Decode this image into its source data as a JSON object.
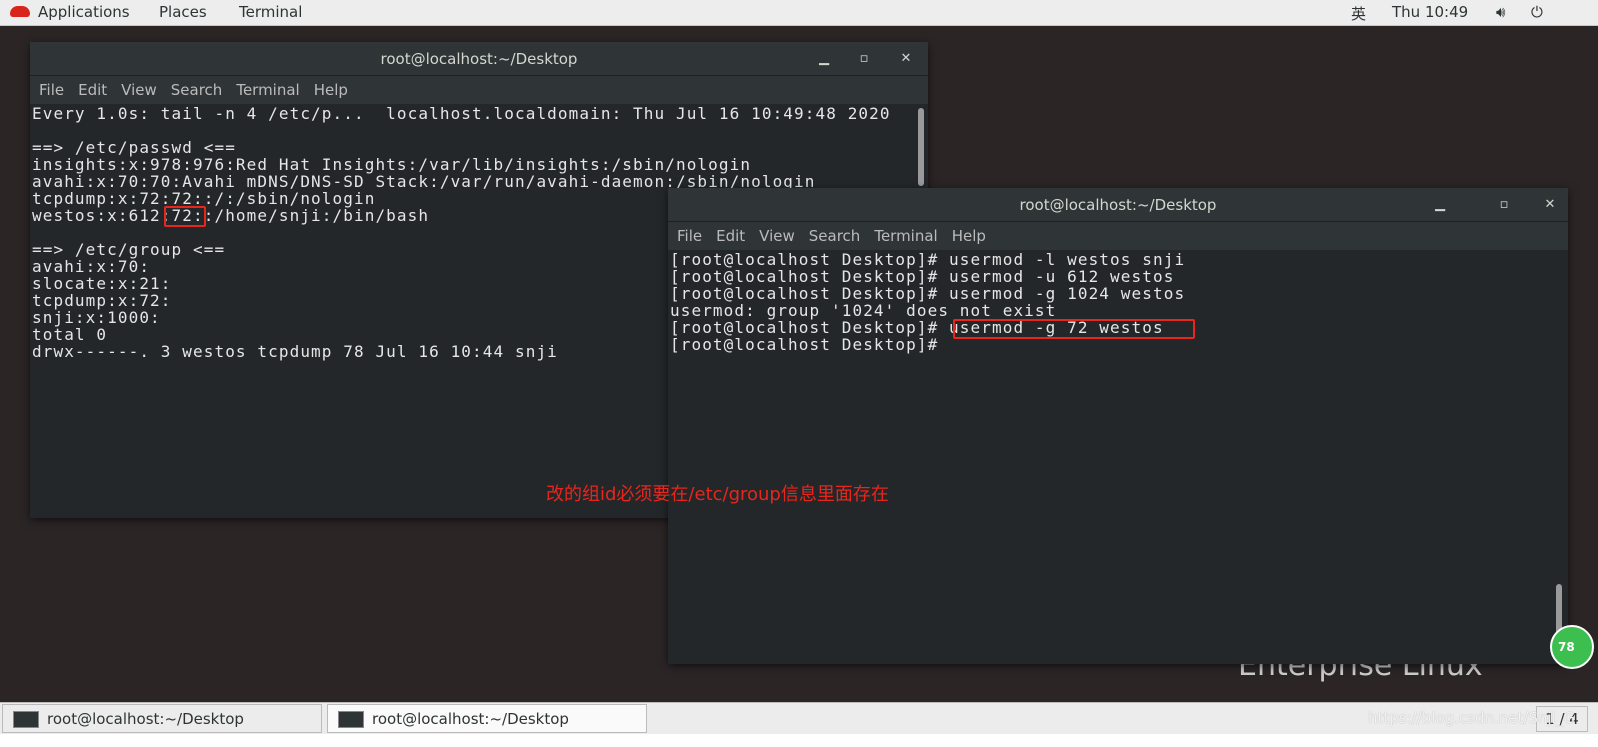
{
  "topbar": {
    "applications": "Applications",
    "places": "Places",
    "terminal": "Terminal",
    "input_method": "英",
    "clock": "Thu 10:49"
  },
  "menu": [
    "File",
    "Edit",
    "View",
    "Search",
    "Terminal",
    "Help"
  ],
  "left_window": {
    "title": "root@localhost:~/Desktop",
    "lines": [
      "Every 1.0s: tail -n 4 /etc/p...  localhost.localdomain: Thu Jul 16 10:49:48 2020",
      "",
      "==> /etc/passwd <==",
      "insights:x:978:976:Red Hat Insights:/var/lib/insights:/sbin/nologin",
      "avahi:x:70:70:Avahi mDNS/DNS-SD Stack:/var/run/avahi-daemon:/sbin/nologin",
      "tcpdump:x:72:72::/:/sbin/nologin",
      "westos:x:612:72::/home/snji:/bin/bash",
      "",
      "==> /etc/group <==",
      "avahi:x:70:",
      "slocate:x:21:",
      "tcpdump:x:72:",
      "snji:x:1000:",
      "total 0",
      "drwx------. 3 westos tcpdump 78 Jul 16 10:44 snji"
    ]
  },
  "right_window": {
    "title": "root@localhost:~/Desktop",
    "lines": [
      "[root@localhost Desktop]# usermod -l westos snji",
      "[root@localhost Desktop]# usermod -u 612 westos",
      "[root@localhost Desktop]# usermod -g 1024 westos",
      "usermod: group '1024' does not exist",
      "[root@localhost Desktop]# usermod -g 72 westos",
      "[root@localhost Desktop]# "
    ]
  },
  "annotation": "改的组id必须要在/etc/group信息里面存在",
  "desktop_text": "Enterprise Linux",
  "badge": "78",
  "taskbar": {
    "tasks": [
      "root@localhost:~/Desktop",
      "root@localhost:~/Desktop"
    ],
    "workspace": "1 / 4"
  },
  "watermark": "https://blog.csdn.net/Snji_G",
  "colors": {
    "annotation": "#e8261c",
    "terminal_bg": "#232729"
  }
}
